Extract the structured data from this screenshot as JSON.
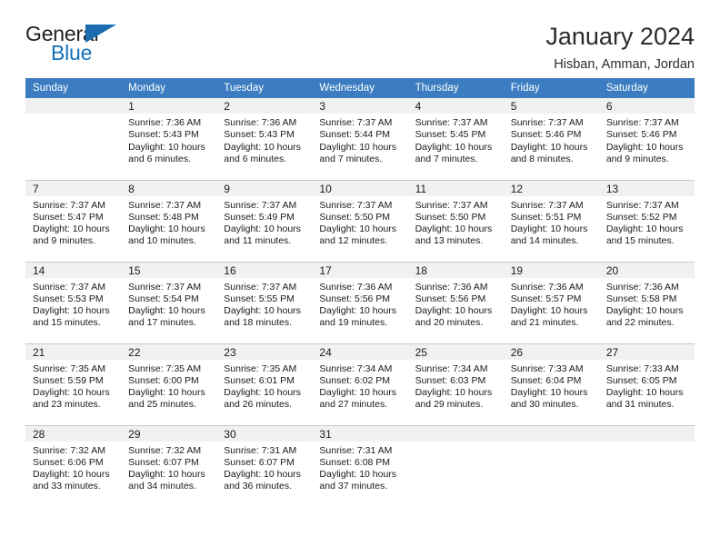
{
  "brand": {
    "name_top": "General",
    "name_bottom": "Blue",
    "color_dark": "#231f20",
    "color_blue": "#1573bb",
    "triangle_color": "#1b6cb0"
  },
  "header": {
    "title": "January 2024",
    "subtitle": "Hisban, Amman, Jordan",
    "header_bg": "#3b7dc0",
    "daynum_bg": "#f1f1f1"
  },
  "weekdays": [
    "Sunday",
    "Monday",
    "Tuesday",
    "Wednesday",
    "Thursday",
    "Friday",
    "Saturday"
  ],
  "labels": {
    "sunrise": "Sunrise:",
    "sunset": "Sunset:",
    "daylight": "Daylight:"
  },
  "weeks": [
    [
      {
        "day": "",
        "blank": true
      },
      {
        "day": "1",
        "l1": "Sunrise: 7:36 AM",
        "l2": "Sunset: 5:43 PM",
        "l3": "Daylight: 10 hours",
        "l4": "and 6 minutes."
      },
      {
        "day": "2",
        "l1": "Sunrise: 7:36 AM",
        "l2": "Sunset: 5:43 PM",
        "l3": "Daylight: 10 hours",
        "l4": "and 6 minutes."
      },
      {
        "day": "3",
        "l1": "Sunrise: 7:37 AM",
        "l2": "Sunset: 5:44 PM",
        "l3": "Daylight: 10 hours",
        "l4": "and 7 minutes."
      },
      {
        "day": "4",
        "l1": "Sunrise: 7:37 AM",
        "l2": "Sunset: 5:45 PM",
        "l3": "Daylight: 10 hours",
        "l4": "and 7 minutes."
      },
      {
        "day": "5",
        "l1": "Sunrise: 7:37 AM",
        "l2": "Sunset: 5:46 PM",
        "l3": "Daylight: 10 hours",
        "l4": "and 8 minutes."
      },
      {
        "day": "6",
        "l1": "Sunrise: 7:37 AM",
        "l2": "Sunset: 5:46 PM",
        "l3": "Daylight: 10 hours",
        "l4": "and 9 minutes."
      }
    ],
    [
      {
        "day": "7",
        "l1": "Sunrise: 7:37 AM",
        "l2": "Sunset: 5:47 PM",
        "l3": "Daylight: 10 hours",
        "l4": "and 9 minutes."
      },
      {
        "day": "8",
        "l1": "Sunrise: 7:37 AM",
        "l2": "Sunset: 5:48 PM",
        "l3": "Daylight: 10 hours",
        "l4": "and 10 minutes."
      },
      {
        "day": "9",
        "l1": "Sunrise: 7:37 AM",
        "l2": "Sunset: 5:49 PM",
        "l3": "Daylight: 10 hours",
        "l4": "and 11 minutes."
      },
      {
        "day": "10",
        "l1": "Sunrise: 7:37 AM",
        "l2": "Sunset: 5:50 PM",
        "l3": "Daylight: 10 hours",
        "l4": "and 12 minutes."
      },
      {
        "day": "11",
        "l1": "Sunrise: 7:37 AM",
        "l2": "Sunset: 5:50 PM",
        "l3": "Daylight: 10 hours",
        "l4": "and 13 minutes."
      },
      {
        "day": "12",
        "l1": "Sunrise: 7:37 AM",
        "l2": "Sunset: 5:51 PM",
        "l3": "Daylight: 10 hours",
        "l4": "and 14 minutes."
      },
      {
        "day": "13",
        "l1": "Sunrise: 7:37 AM",
        "l2": "Sunset: 5:52 PM",
        "l3": "Daylight: 10 hours",
        "l4": "and 15 minutes."
      }
    ],
    [
      {
        "day": "14",
        "l1": "Sunrise: 7:37 AM",
        "l2": "Sunset: 5:53 PM",
        "l3": "Daylight: 10 hours",
        "l4": "and 15 minutes."
      },
      {
        "day": "15",
        "l1": "Sunrise: 7:37 AM",
        "l2": "Sunset: 5:54 PM",
        "l3": "Daylight: 10 hours",
        "l4": "and 17 minutes."
      },
      {
        "day": "16",
        "l1": "Sunrise: 7:37 AM",
        "l2": "Sunset: 5:55 PM",
        "l3": "Daylight: 10 hours",
        "l4": "and 18 minutes."
      },
      {
        "day": "17",
        "l1": "Sunrise: 7:36 AM",
        "l2": "Sunset: 5:56 PM",
        "l3": "Daylight: 10 hours",
        "l4": "and 19 minutes."
      },
      {
        "day": "18",
        "l1": "Sunrise: 7:36 AM",
        "l2": "Sunset: 5:56 PM",
        "l3": "Daylight: 10 hours",
        "l4": "and 20 minutes."
      },
      {
        "day": "19",
        "l1": "Sunrise: 7:36 AM",
        "l2": "Sunset: 5:57 PM",
        "l3": "Daylight: 10 hours",
        "l4": "and 21 minutes."
      },
      {
        "day": "20",
        "l1": "Sunrise: 7:36 AM",
        "l2": "Sunset: 5:58 PM",
        "l3": "Daylight: 10 hours",
        "l4": "and 22 minutes."
      }
    ],
    [
      {
        "day": "21",
        "l1": "Sunrise: 7:35 AM",
        "l2": "Sunset: 5:59 PM",
        "l3": "Daylight: 10 hours",
        "l4": "and 23 minutes."
      },
      {
        "day": "22",
        "l1": "Sunrise: 7:35 AM",
        "l2": "Sunset: 6:00 PM",
        "l3": "Daylight: 10 hours",
        "l4": "and 25 minutes."
      },
      {
        "day": "23",
        "l1": "Sunrise: 7:35 AM",
        "l2": "Sunset: 6:01 PM",
        "l3": "Daylight: 10 hours",
        "l4": "and 26 minutes."
      },
      {
        "day": "24",
        "l1": "Sunrise: 7:34 AM",
        "l2": "Sunset: 6:02 PM",
        "l3": "Daylight: 10 hours",
        "l4": "and 27 minutes."
      },
      {
        "day": "25",
        "l1": "Sunrise: 7:34 AM",
        "l2": "Sunset: 6:03 PM",
        "l3": "Daylight: 10 hours",
        "l4": "and 29 minutes."
      },
      {
        "day": "26",
        "l1": "Sunrise: 7:33 AM",
        "l2": "Sunset: 6:04 PM",
        "l3": "Daylight: 10 hours",
        "l4": "and 30 minutes."
      },
      {
        "day": "27",
        "l1": "Sunrise: 7:33 AM",
        "l2": "Sunset: 6:05 PM",
        "l3": "Daylight: 10 hours",
        "l4": "and 31 minutes."
      }
    ],
    [
      {
        "day": "28",
        "l1": "Sunrise: 7:32 AM",
        "l2": "Sunset: 6:06 PM",
        "l3": "Daylight: 10 hours",
        "l4": "and 33 minutes."
      },
      {
        "day": "29",
        "l1": "Sunrise: 7:32 AM",
        "l2": "Sunset: 6:07 PM",
        "l3": "Daylight: 10 hours",
        "l4": "and 34 minutes."
      },
      {
        "day": "30",
        "l1": "Sunrise: 7:31 AM",
        "l2": "Sunset: 6:07 PM",
        "l3": "Daylight: 10 hours",
        "l4": "and 36 minutes."
      },
      {
        "day": "31",
        "l1": "Sunrise: 7:31 AM",
        "l2": "Sunset: 6:08 PM",
        "l3": "Daylight: 10 hours",
        "l4": "and 37 minutes."
      },
      {
        "day": "",
        "blank": true
      },
      {
        "day": "",
        "blank": true
      },
      {
        "day": "",
        "blank": true
      }
    ]
  ]
}
